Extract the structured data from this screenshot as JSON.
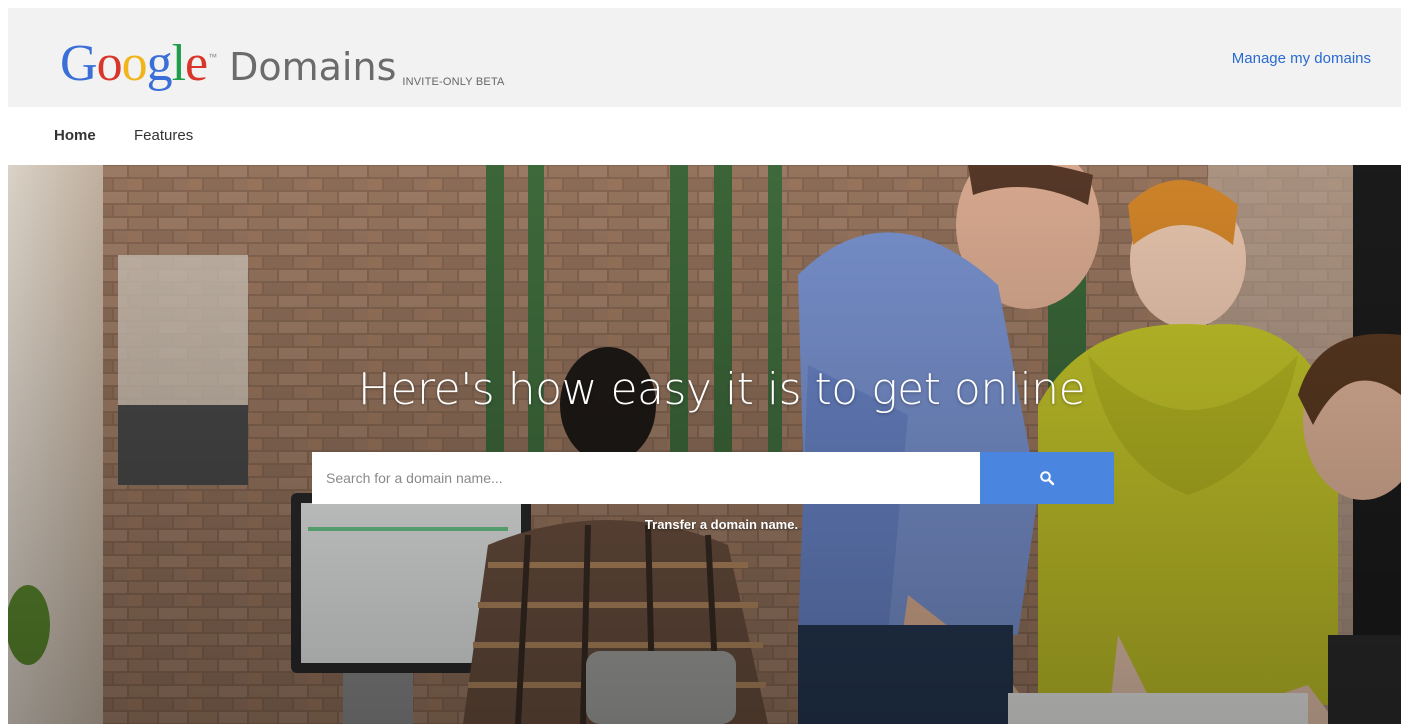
{
  "brand": {
    "google_letters": [
      "G",
      "o",
      "o",
      "g",
      "l",
      "e"
    ],
    "trademark": "™",
    "product": "Domains",
    "badge": "INVITE-ONLY BETA",
    "colors": {
      "blue": "#3b6fd8",
      "red": "#d9362b",
      "yellow": "#f1b51c",
      "green": "#1e9d4a"
    }
  },
  "header": {
    "manage_link": "Manage my domains",
    "background": "#f2f2f2",
    "link_color": "#2a6ad1"
  },
  "nav": {
    "items": [
      {
        "label": "Home",
        "active": true
      },
      {
        "label": "Features",
        "active": false
      }
    ]
  },
  "hero": {
    "headline": "Here's how easy it is to get online",
    "search": {
      "placeholder": "Search for a domain name...",
      "value": "",
      "button_icon": "search-icon",
      "button_color": "#4a86df"
    },
    "transfer_link": "Transfer a domain name."
  }
}
